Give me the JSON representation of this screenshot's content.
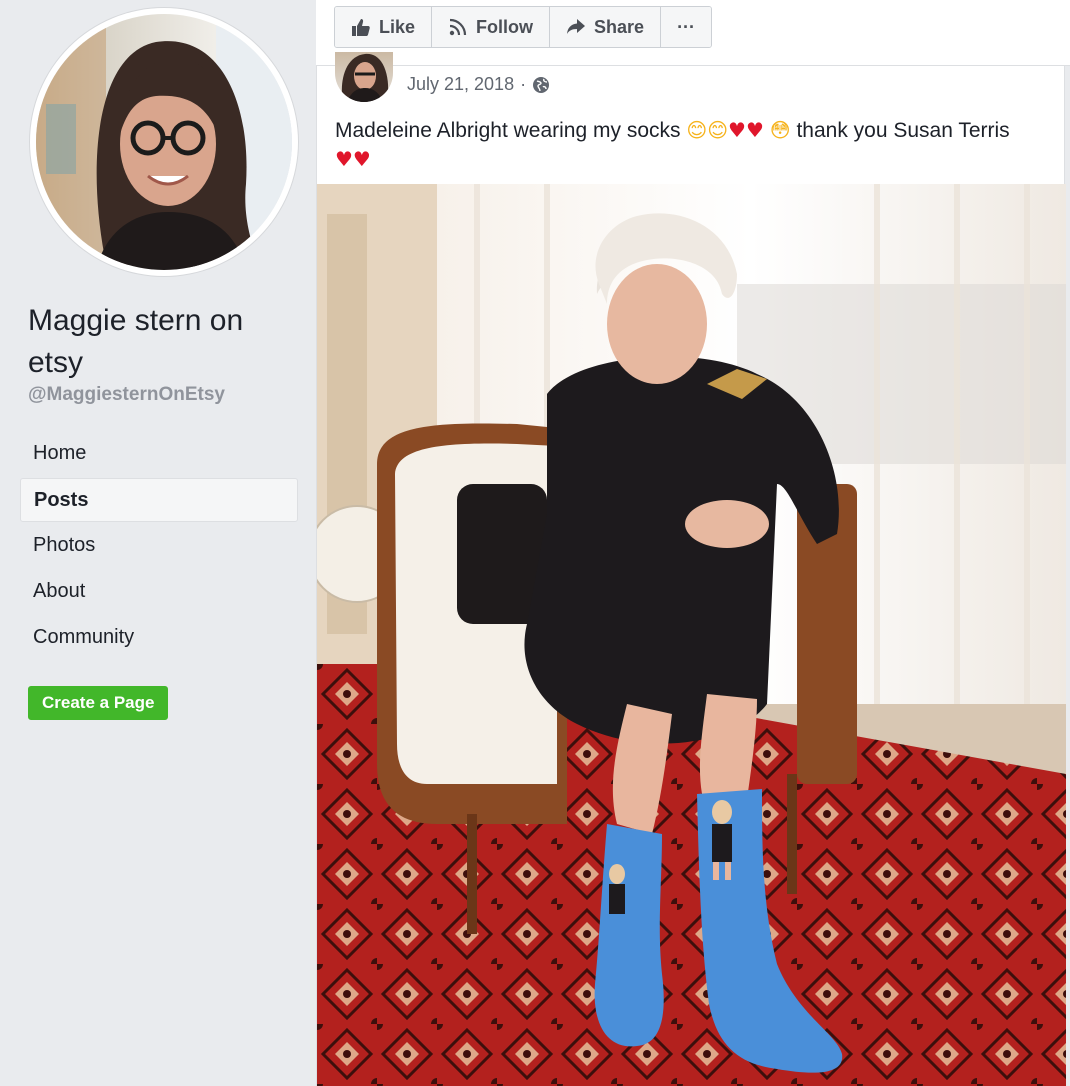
{
  "sidebar": {
    "page_name": "Maggie stern on etsy",
    "handle": "@MaggiesternOnEtsy",
    "nav": [
      {
        "label": "Home",
        "active": false
      },
      {
        "label": "Posts",
        "active": true
      },
      {
        "label": "Photos",
        "active": false
      },
      {
        "label": "About",
        "active": false
      },
      {
        "label": "Community",
        "active": false
      }
    ],
    "create_page_label": "Create a Page"
  },
  "toolbar": {
    "like_label": "Like",
    "follow_label": "Follow",
    "share_label": "Share",
    "more_label": "···"
  },
  "post": {
    "date": "July 21, 2018",
    "separator": "·",
    "privacy_icon": "globe-icon",
    "text_before": "Madeleine Albright wearing my socks",
    "emojis_1": "😊😊",
    "hearts_1": "♥♥",
    "emoji_flushed": "😳",
    "text_after": "thank you Susan Terris",
    "hearts_2": "♥♥"
  },
  "colors": {
    "page_bg": "#e9ebee",
    "create_button": "#42b72a",
    "heart": "#e0162b",
    "sock_blue": "#4a8fd9",
    "rug_red": "#b3211e"
  }
}
